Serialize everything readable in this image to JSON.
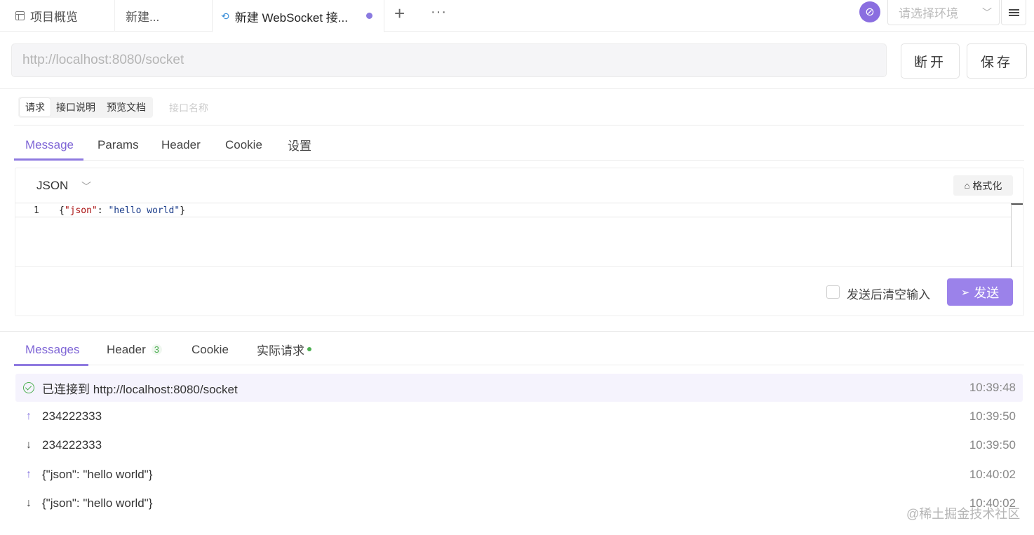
{
  "tabs": {
    "overview": "项目概览",
    "new": "新建...",
    "active": "新建 WebSocket 接...",
    "plus": "+",
    "more": "···"
  },
  "env": {
    "placeholder": "请选择环境"
  },
  "url": {
    "value": "http://localhost:8080/socket"
  },
  "buttons": {
    "disconnect": "断开",
    "save": "保存"
  },
  "segments": [
    "请求",
    "接口说明",
    "预览文档"
  ],
  "name_placeholder": "接口名称",
  "request_tabs": [
    "Message",
    "Params",
    "Header",
    "Cookie",
    "设置"
  ],
  "editor": {
    "language": "JSON",
    "format_label": "格式化",
    "line_number": "1",
    "code_open": "{",
    "code_key": "\"json\"",
    "code_colon": ": ",
    "code_value": "\"hello world\"",
    "code_close": "}"
  },
  "clear_after_send": "发送后清空输入",
  "send_label": "发送",
  "response_tabs": {
    "messages": "Messages",
    "header": "Header",
    "header_count": "3",
    "cookie": "Cookie",
    "actual": "实际请求"
  },
  "messages": [
    {
      "direction": "connected",
      "text": "已连接到 http://localhost:8080/socket",
      "time": "10:39:48"
    },
    {
      "direction": "up",
      "text": "234222333",
      "time": "10:39:50"
    },
    {
      "direction": "down",
      "text": "234222333",
      "time": "10:39:50"
    },
    {
      "direction": "up",
      "text": "{\"json\": \"hello world\"}",
      "time": "10:40:02"
    },
    {
      "direction": "down",
      "text": "{\"json\": \"hello world\"}",
      "time": "10:40:02"
    }
  ],
  "watermark": "@稀土掘金技术社区",
  "colors": {
    "accent": "#8a7ae0",
    "send_button": "#9b82ea",
    "success": "#4caf50"
  }
}
